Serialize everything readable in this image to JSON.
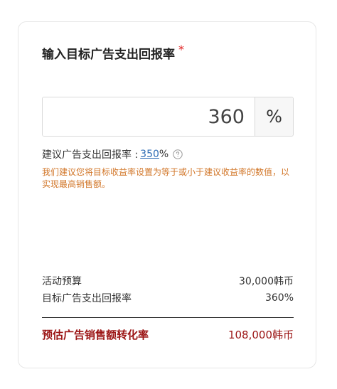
{
  "title": "输入目标广告支出回报率",
  "required_mark": "*",
  "roas_input": {
    "value": "360",
    "unit": "%"
  },
  "recommend": {
    "label": "建议广告支出回报率 :",
    "value": "350",
    "unit": "%",
    "help_icon": "help-circle-icon"
  },
  "note": "我们建议您将目标收益率设置为等于或小于建议收益率的数值，以实现最高销售额。",
  "summary": {
    "rows": [
      {
        "label": "活动预算",
        "value": "30,000韩币"
      },
      {
        "label": "目标广告支出回报率",
        "value": "360%"
      }
    ]
  },
  "total": {
    "label": "预估广告销售额转化率",
    "value": "108,000韩币"
  },
  "colors": {
    "required": "#e02020",
    "link": "#2f6db5",
    "note": "#d2772a",
    "total": "#9b1414",
    "border": "#e6e6e6"
  }
}
